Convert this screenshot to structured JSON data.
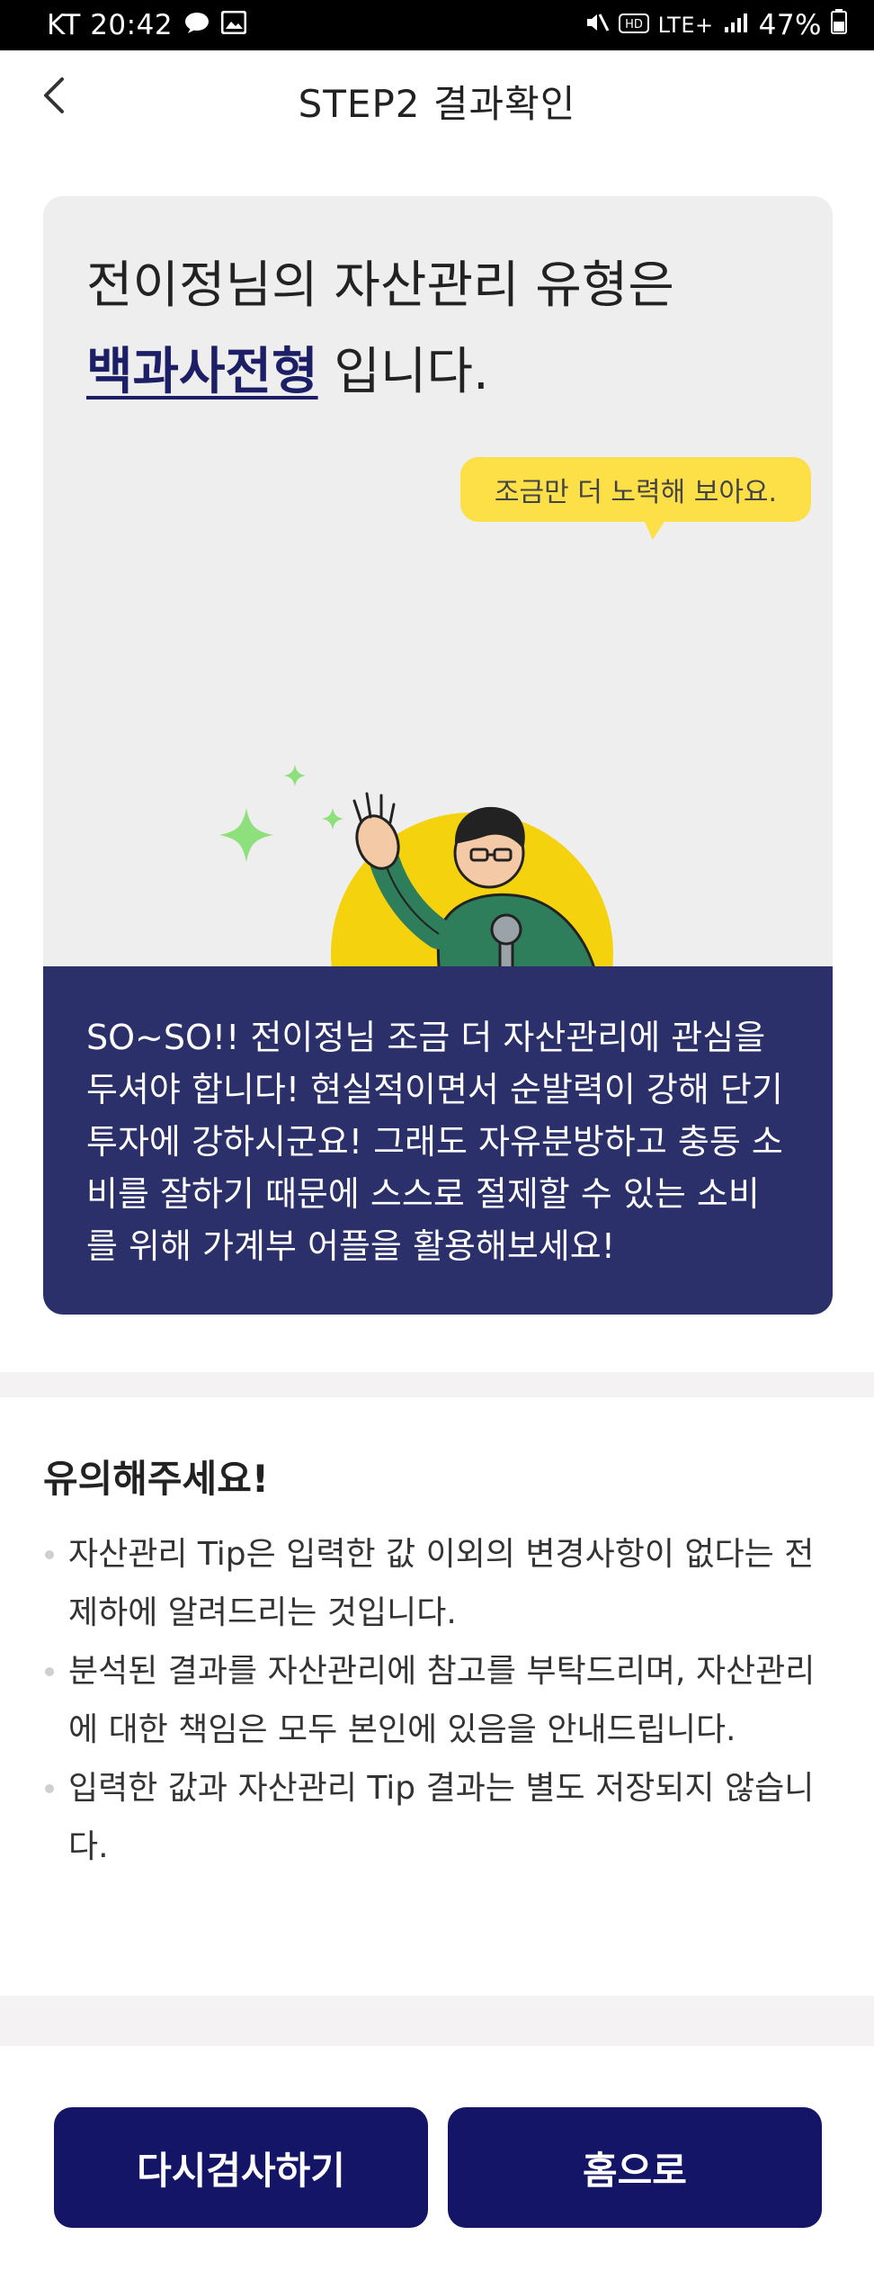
{
  "status_bar": {
    "carrier_time": "KT 20:42",
    "network": "LTE+",
    "battery": "47%"
  },
  "header": {
    "title": "STEP2 결과확인"
  },
  "result": {
    "line1": "전이정님의 자산관리 유형은",
    "type_name": "백과사전형",
    "line2_suffix": " 입니다.",
    "bubble": "조금만 더 노력해 보아요.",
    "description": "SO~SO!! 전이정님 조금 더 자산관리에 관심을 두셔야 합니다! 현실적이면서 순발력이 강해 단기 투자에 강하시군요! 그래도 자유분방하고 충동 소비를 잘하기 때문에 스스로 절제할 수 있는 소비를 위해 가계부 어플을 활용해보세요!"
  },
  "notice": {
    "title": "유의해주세요!",
    "items": [
      "자산관리 Tip은 입력한 값 이외의 변경사항이 없다는 전제하에 알려드리는 것입니다.",
      "분석된 결과를 자산관리에 참고를 부탁드리며, 자산관리에 대한 책임은 모두 본인에 있음을 안내드립니다.",
      "입력한 값과 자산관리 Tip 결과는 별도 저장되지 않습니다."
    ]
  },
  "buttons": {
    "retry": "다시검사하기",
    "home": "홈으로"
  },
  "colors": {
    "navy_button": "#141566",
    "navy_panel": "#2b2f6a",
    "highlight_text": "#1c1f66",
    "bubble_yellow": "#fde047",
    "card_gray": "#eeeeee"
  }
}
